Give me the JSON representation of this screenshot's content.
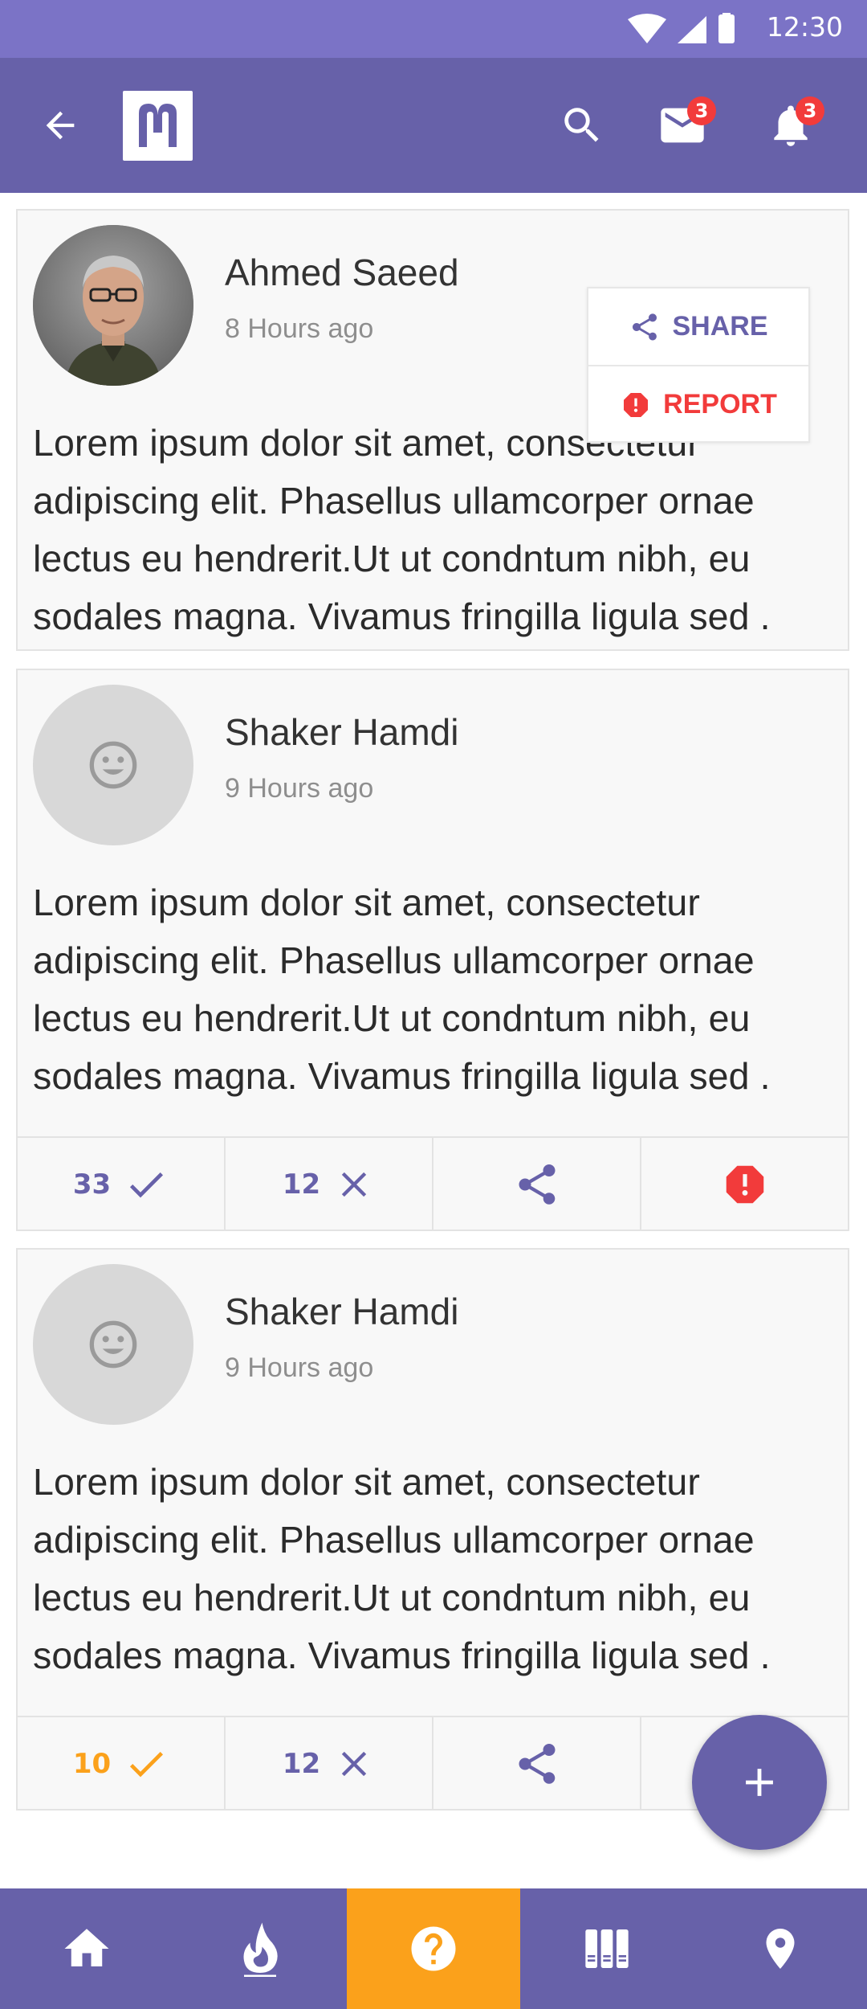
{
  "status_bar": {
    "time": "12:30"
  },
  "app_bar": {
    "mail_badge": "3",
    "notification_badge": "3",
    "icons": [
      "arrow-back-icon",
      "logo",
      "search-icon",
      "mail-icon",
      "bell-icon"
    ]
  },
  "popup_menu": {
    "share_label": "SHARE",
    "report_label": "REPORT"
  },
  "posts": [
    {
      "author": "Ahmed Saeed",
      "time": "8 Hours ago",
      "lines": [
        "Lorem ipsum dolor sit amet, consectetur",
        "adipiscing elit. Phasellus ullamcorper ornae",
        "lectus eu hendrerit.Ut ut condntum nibh, eu",
        "sodales magna. Vivamus fringilla ligula sed ."
      ]
    },
    {
      "author": "Shaker Hamdi",
      "time": "9 Hours ago",
      "lines": [
        "Lorem ipsum dolor sit amet, consectetur",
        "adipiscing elit. Phasellus ullamcorper ornae",
        "lectus eu hendrerit.Ut ut condntum nibh, eu",
        "sodales magna. Vivamus fringilla ligula sed ."
      ],
      "agree_count": "33",
      "disagree_count": "12"
    },
    {
      "author": "Shaker Hamdi",
      "time": "9 Hours ago",
      "lines": [
        "Lorem ipsum dolor sit amet, consectetur",
        "adipiscing elit. Phasellus ullamcorper ornae",
        "lectus eu hendrerit.Ut ut condntum nibh, eu",
        "sodales magna. Vivamus fringilla ligula sed ."
      ],
      "agree_count": "10",
      "disagree_count": "12"
    }
  ],
  "bottom_nav": {
    "items": [
      "home-icon",
      "fire-icon",
      "question-icon",
      "library-icon",
      "location-pin-icon"
    ],
    "active": "question-icon"
  },
  "colors": {
    "primary": "#6761a9",
    "status_bar": "#7b73c6",
    "accent": "#fba11b",
    "danger": "#f23b3b"
  }
}
